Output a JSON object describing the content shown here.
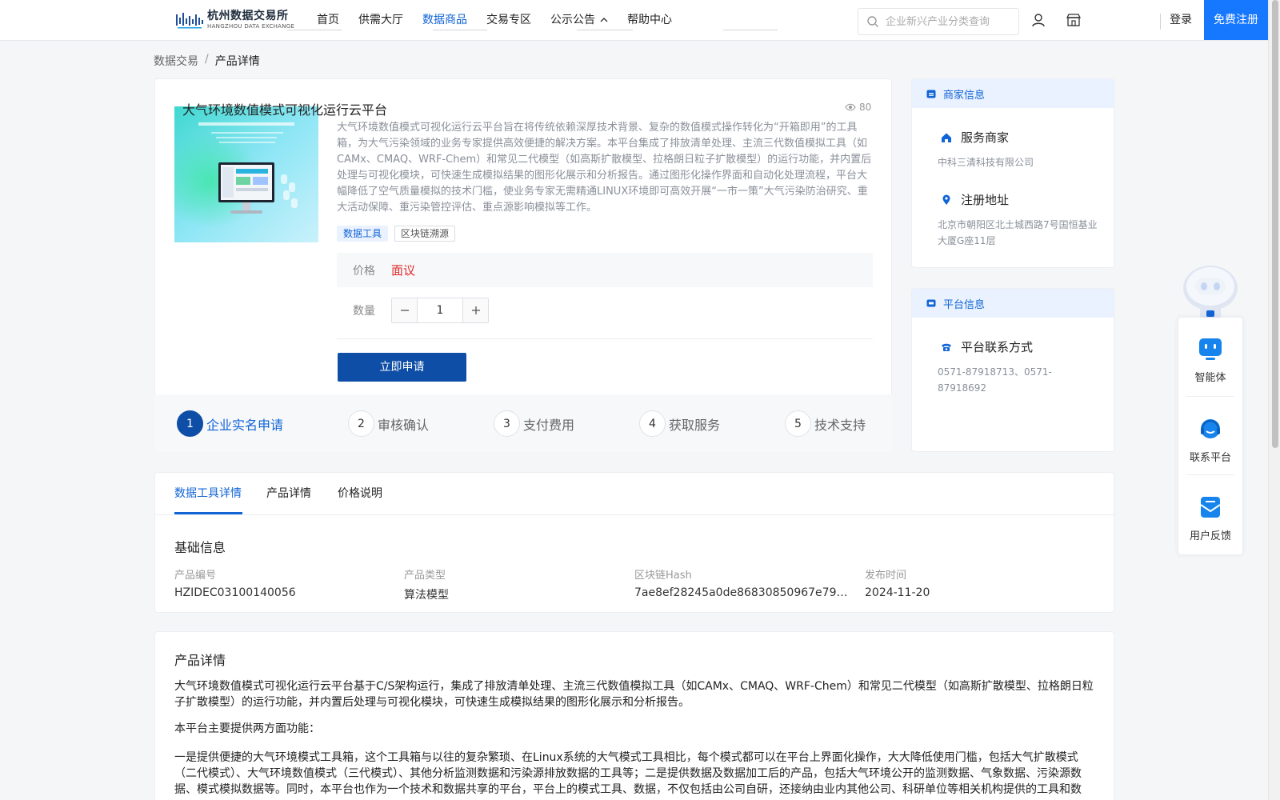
{
  "header": {
    "logo_cn": "杭州数据交易所",
    "logo_en": "HANGZHOU DATA EXCHANGE",
    "nav": [
      {
        "label": "首页"
      },
      {
        "label": "供需大厅"
      },
      {
        "label": "数据商品",
        "active": true
      },
      {
        "label": "交易专区"
      },
      {
        "label": "公示公告",
        "has_dropdown": true
      },
      {
        "label": "帮助中心"
      }
    ],
    "search_placeholder": "企业新兴产业分类查询",
    "login": "登录",
    "register": "免费注册"
  },
  "breadcrumb": {
    "root": "数据交易",
    "separator": "/",
    "current": "产品详情"
  },
  "product": {
    "title": "大气环境数值模式可视化运行云平台",
    "views": "80",
    "description": "大气环境数值模式可视化运行云平台旨在将传统依赖深厚技术背景、复杂的数值模式操作转化为“开箱即用”的工具箱，为大气污染领域的业务专家提供高效便捷的解决方案。本平台集成了排放清单处理、主流三代数值模拟工具（如CAMx、CMAQ、WRF-Chem）和常见二代模型（如高斯扩散模型、拉格朗日粒子扩散模型）的运行功能，并内置后处理与可视化模块，可快速生成模拟结果的图形化展示和分析报告。通过图形化操作界面和自动化处理流程，平台大幅降低了空气质量模拟的技术门槛，使业务专家无需精通LINUX环境即可高效开展“一市一策”大气污染防治研究、重大活动保障、重污染管控评估、重点源影响模拟等工作。",
    "tags": [
      "数据工具",
      "区块链溯源"
    ],
    "price_label": "价格",
    "price_value": "面议",
    "qty_label": "数量",
    "qty_value": "1",
    "apply_label": "立即申请"
  },
  "steps": [
    {
      "num": "1",
      "label": "企业实名申请",
      "active": true
    },
    {
      "num": "2",
      "label": "审核确认"
    },
    {
      "num": "3",
      "label": "支付费用"
    },
    {
      "num": "4",
      "label": "获取服务"
    },
    {
      "num": "5",
      "label": "技术支持"
    }
  ],
  "merchant": {
    "heading": "商家信息",
    "service_label": "服务商家",
    "service_value": "中科三清科技有限公司",
    "address_label": "注册地址",
    "address_value": "北京市朝阳区北土城西路7号国恒基业大厦G座11层"
  },
  "platform": {
    "heading": "平台信息",
    "contact_label": "平台联系方式",
    "contact_value": "0571-87918713、0571-87918692"
  },
  "float_widget": [
    {
      "label": "智能体",
      "icon": "agent-icon"
    },
    {
      "label": "联系平台",
      "icon": "headset-icon"
    },
    {
      "label": "用户反馈",
      "icon": "feedback-icon"
    }
  ],
  "tabs": {
    "items": [
      {
        "label": "数据工具详情",
        "active": true
      },
      {
        "label": "产品详情"
      },
      {
        "label": "价格说明"
      }
    ],
    "basic_info_title": "基础信息",
    "fields": [
      {
        "label": "产品编号",
        "value": "HZIDEC03100140056"
      },
      {
        "label": "产品类型",
        "value": "算法模型"
      },
      {
        "label": "区块链Hash",
        "value": "7ae8ef28245a0de86830850967e79aaada..."
      },
      {
        "label": "发布时间",
        "value": "2024-11-20"
      }
    ]
  },
  "detail": {
    "title": "产品详情",
    "p1": "大气环境数值模式可视化运行云平台基于C/S架构运行，集成了排放清单处理、主流三代数值模拟工具（如CAMx、CMAQ、WRF-Chem）和常见二代模型（如高斯扩散模型、拉格朗日粒子扩散模型）的运行功能，并内置后处理与可视化模块，可快速生成模拟结果的图形化展示和分析报告。",
    "p2": "本平台主要提供两方面功能：",
    "p3": "一是提供便捷的大气环境模式工具箱，这个工具箱与以往的复杂繁琐、在Linux系统的大气模式工具相比，每个模式都可以在平台上界面化操作，大大降低使用门槛，包括大气扩散模式（二代模式）、大气环境数值模式（三代模式）、其他分析监测数据和污染源排放数据的工具等；二是提供数据及数据加工后的产品，包括大气环境公开的监测数据、气象数据、污染源数据、模式模拟数据等。同时，本平台也作为一个技术和数据共享的平台，平台上的模式工具、数据，不仅包括由公司自研，还接纳由业内其他公司、科研单位等相关机构提供的工具和数"
  },
  "colors": {
    "primary": "#1164d6",
    "button": "#0f4ea6",
    "register": "#1677ff",
    "price": "#e02b2b"
  }
}
